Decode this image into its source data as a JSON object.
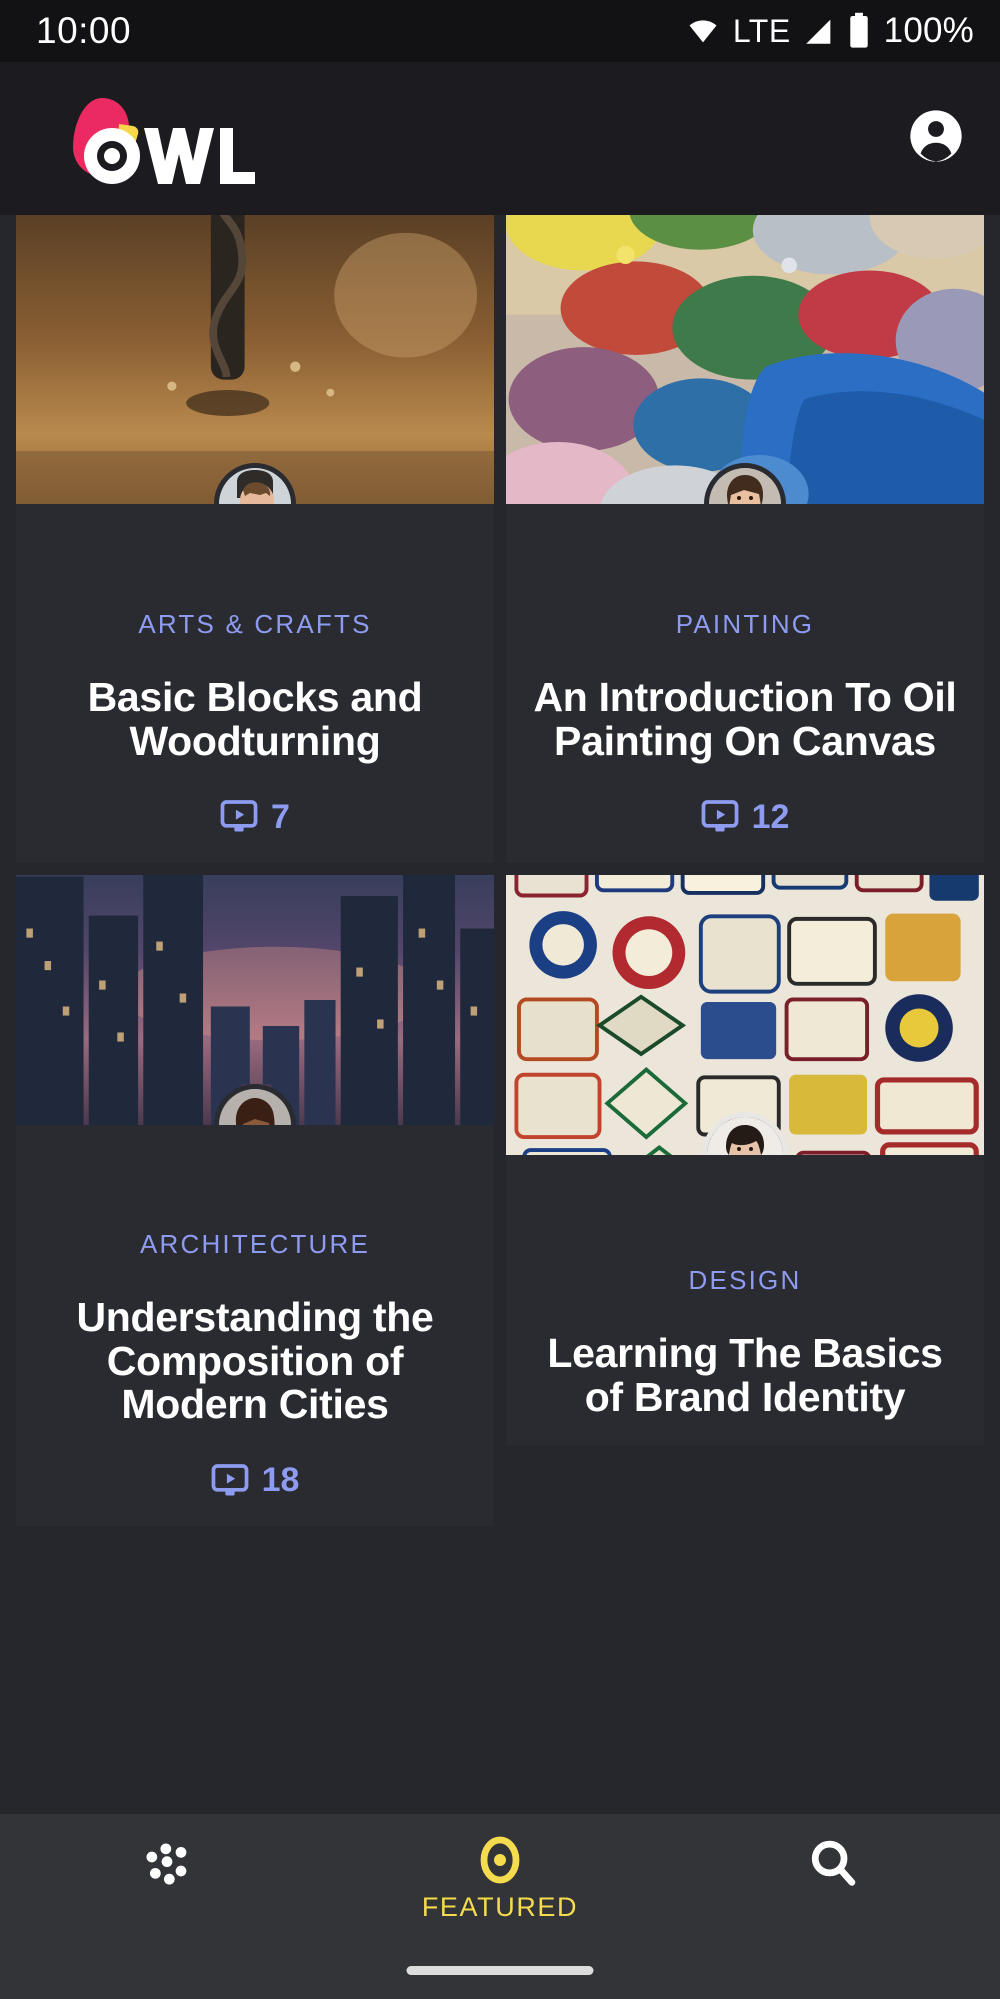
{
  "status_bar": {
    "time": "10:00",
    "network_label": "LTE",
    "battery_percent": "100%",
    "icons": [
      "wifi-icon",
      "signal-icon",
      "battery-icon"
    ]
  },
  "header": {
    "brand_name": "OWL",
    "brand_colors": {
      "bird": "#ec2a62",
      "beak": "#f7d64a",
      "wordmark": "#ffffff"
    },
    "profile_icon": "account-circle-icon"
  },
  "theme": {
    "page_background": "#1c1c20",
    "card_background": "#2a2b31",
    "accent_category": "#8d9bf0",
    "accent_active_nav": "#f5dc4e",
    "nav_background": "#333438"
  },
  "cards": [
    {
      "id": "basic-blocks-and-woodturning",
      "category": "ARTS & CRAFTS",
      "title": "Basic Blocks and Woodturning",
      "video_count": "7",
      "meta_icon": "video-monitor-icon",
      "thumbnail_alt": "drill-bit-boring-into-wood",
      "author_avatar_alt": "young-man-smiling-in-blue-shirt"
    },
    {
      "id": "an-introduction-to-oil-painting-on-canvas",
      "category": "PAINTING",
      "title": "An Introduction To Oil Painting On Canvas",
      "video_count": "12",
      "meta_icon": "video-monitor-icon",
      "thumbnail_alt": "colorful-oil-paint-palette",
      "author_avatar_alt": "woman-with-hand-near-face"
    },
    {
      "id": "understanding-the-composition-of-modern-cities",
      "category": "ARCHITECTURE",
      "title": "Understanding the Composition of Modern Cities",
      "video_count": "18",
      "meta_icon": "video-monitor-icon",
      "thumbnail_alt": "city-skyline-at-dusk-with-skyscrapers",
      "author_avatar_alt": "smiling-woman-with-long-hair"
    },
    {
      "id": "learning-the-basics-of-brand-identity",
      "category": "DESIGN",
      "title": "Learning The Basics of Brand Identity",
      "video_count": "",
      "meta_icon": "video-monitor-icon",
      "thumbnail_alt": "wall-of-embroidered-patches-and-badges",
      "author_avatar_alt": "woman-with-short-dark-hair"
    }
  ],
  "bottom_nav": {
    "items": [
      {
        "id": "browse",
        "icon": "dots-grid-icon",
        "label": "",
        "active": false
      },
      {
        "id": "featured",
        "icon": "eye-owl-icon",
        "label": "FEATURED",
        "active": true
      },
      {
        "id": "search",
        "icon": "search-icon",
        "label": "",
        "active": false
      }
    ]
  }
}
